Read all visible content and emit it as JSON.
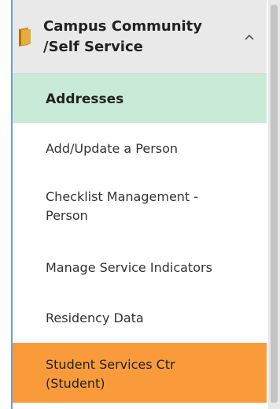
{
  "header": {
    "title_line1": "Campus Community",
    "title_line2": "/Self Service",
    "icon": "folder-icon",
    "toggle_icon": "chevron-up-icon"
  },
  "menu": {
    "items": [
      {
        "label": "Addresses",
        "state": "selected"
      },
      {
        "label": "Add/Update a Person"
      },
      {
        "label_line1": "Checklist Management -",
        "label_line2": "Person"
      },
      {
        "label": "Manage Service Indicators"
      },
      {
        "label": "Residency Data"
      },
      {
        "label_line1": "Student Services Ctr",
        "label_line2": "(Student)",
        "state": "hover"
      }
    ]
  },
  "colors": {
    "header_bg": "#e9e9e9",
    "selected_bg": "#c8ead6",
    "hover_bg": "#f99b3a",
    "left_border": "#6f9ed4",
    "folder_icon": "#d9a534"
  }
}
